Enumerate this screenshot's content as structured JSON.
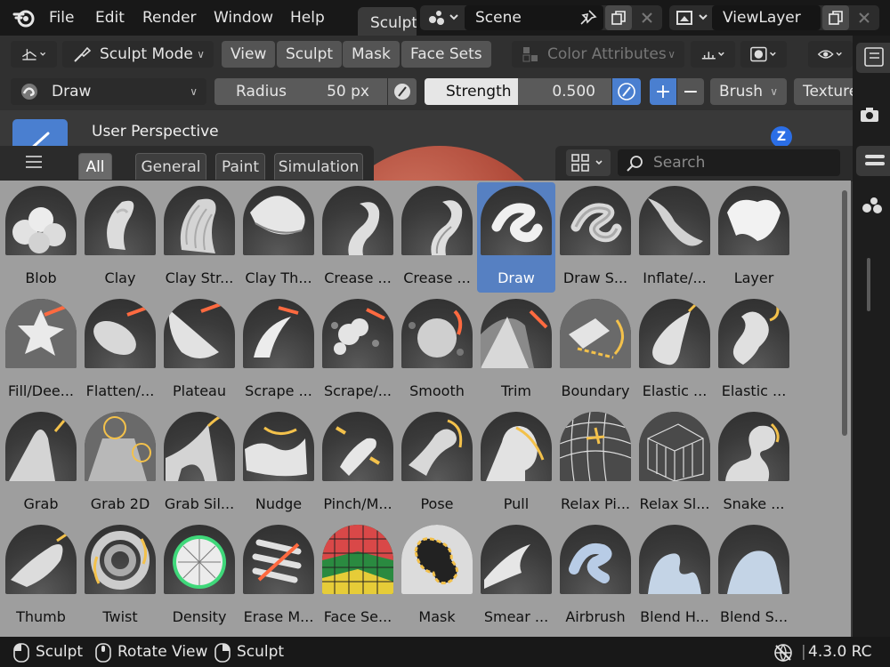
{
  "menu": {
    "file": "File",
    "edit": "Edit",
    "render": "Render",
    "window": "Window",
    "help": "Help"
  },
  "workspace_tab": "Sculpting",
  "scene": {
    "name": "Scene"
  },
  "view_layer": {
    "name": "ViewLayer"
  },
  "header": {
    "mode": "Sculpt Mode",
    "view": "View",
    "sculpt": "Sculpt",
    "mask": "Mask",
    "face_sets": "Face Sets",
    "color_attributes": "Color Attributes"
  },
  "tool_settings": {
    "brush_name": "Draw",
    "radius_label": "Radius",
    "radius_value": "50 px",
    "strength_label": "Strength",
    "strength_value": "0.500",
    "brush_menu": "Brush",
    "texture_menu": "Texture"
  },
  "viewport": {
    "perspective": "User Perspective",
    "axis_z": "Z"
  },
  "shelf": {
    "tabs": [
      "All",
      "General",
      "Paint",
      "Simulation"
    ],
    "active_tab": "All",
    "search_placeholder": "Search",
    "brushes": [
      {
        "label": "Blob"
      },
      {
        "label": "Clay"
      },
      {
        "label": "Clay Str..."
      },
      {
        "label": "Clay Th..."
      },
      {
        "label": "Crease ..."
      },
      {
        "label": "Crease ..."
      },
      {
        "label": "Draw",
        "selected": true
      },
      {
        "label": "Draw S..."
      },
      {
        "label": "Inflate/..."
      },
      {
        "label": "Layer"
      },
      {
        "label": "Fill/Dee..."
      },
      {
        "label": "Flatten/..."
      },
      {
        "label": "Plateau"
      },
      {
        "label": "Scrape ..."
      },
      {
        "label": "Scrape/..."
      },
      {
        "label": "Smooth"
      },
      {
        "label": "Trim"
      },
      {
        "label": "Boundary"
      },
      {
        "label": "Elastic ..."
      },
      {
        "label": "Elastic ..."
      },
      {
        "label": "Grab"
      },
      {
        "label": "Grab 2D"
      },
      {
        "label": "Grab Sil..."
      },
      {
        "label": "Nudge"
      },
      {
        "label": "Pinch/M..."
      },
      {
        "label": "Pose"
      },
      {
        "label": "Pull"
      },
      {
        "label": "Relax Pi..."
      },
      {
        "label": "Relax Sl..."
      },
      {
        "label": "Snake ..."
      },
      {
        "label": "Thumb"
      },
      {
        "label": "Twist"
      },
      {
        "label": "Density"
      },
      {
        "label": "Erase M..."
      },
      {
        "label": "Face Se..."
      },
      {
        "label": "Mask"
      },
      {
        "label": "Smear ..."
      },
      {
        "label": "Airbrush"
      },
      {
        "label": "Blend H..."
      },
      {
        "label": "Blend S..."
      }
    ]
  },
  "status": {
    "left_click": "Sculpt",
    "middle_click": "Rotate View",
    "right_click": "Sculpt",
    "version": "4.3.0 RC"
  },
  "colors": {
    "accent": "#5680c2",
    "sphere": "#b24d3c",
    "shelf_bg": "#9e9e9e"
  }
}
